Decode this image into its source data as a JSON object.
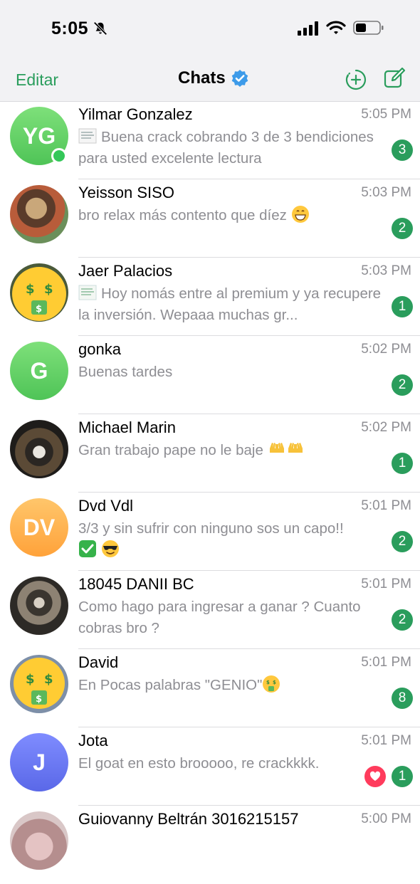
{
  "status": {
    "time": "5:05",
    "icons": [
      "bell-slash-icon",
      "signal-icon",
      "wifi-icon",
      "battery-icon"
    ]
  },
  "nav": {
    "edit": "Editar",
    "title": "Chats",
    "icons": [
      "verified-icon",
      "new-story-icon",
      "compose-icon"
    ]
  },
  "colors": {
    "accent": "#2a9d5c",
    "muted": "#8e8e93",
    "online": "#34c759",
    "heart": "#ff3b5c"
  },
  "chats": [
    {
      "name": "Yilmar Gonzalez",
      "time": "5:05 PM",
      "initials": "YG",
      "preview": "Buena crack cobrando 3 de 3 bendiciones para usted excelente lectura",
      "unread": "3",
      "online": true,
      "has_doc_icon": true
    },
    {
      "name": "Yeisson SISO",
      "time": "5:03 PM",
      "preview": "bro relax más contento que díez",
      "preview_emoji": "grinning-face",
      "unread": "2"
    },
    {
      "name": "Jaer Palacios",
      "time": "5:03 PM",
      "preview": "Hoy nomás entre al premium y ya recupere la inversión. Wepaaa muchas gr...",
      "unread": "1",
      "has_doc_icon": true,
      "avatar_emoji": "money-mouth-face"
    },
    {
      "name": "gonka",
      "time": "5:02 PM",
      "initials": "G",
      "preview": "Buenas tardes",
      "unread": "2"
    },
    {
      "name": "Michael Marin",
      "time": "5:02 PM",
      "preview": "Gran trabajo pape no le baje",
      "preview_emoji": "raising-hands x2",
      "unread": "1"
    },
    {
      "name": "Dvd Vdl",
      "time": "5:01 PM",
      "initials": "DV",
      "preview": "3/3 y sin sufrir con ninguno sos un capo!!",
      "preview_emoji": "check-mark + sunglasses-face",
      "unread": "2"
    },
    {
      "name": "18045 DANII BC",
      "time": "5:01 PM",
      "preview": "Como hago para ingresar a ganar ? Cuanto cobras bro ?",
      "unread": "2"
    },
    {
      "name": "David",
      "time": "5:01 PM",
      "preview": "En Pocas palabras \"GENIO\"",
      "preview_emoji": "money-mouth-face",
      "unread": "8",
      "avatar_emoji": "money-mouth-face"
    },
    {
      "name": "Jota",
      "time": "5:01 PM",
      "initials": "J",
      "preview": "El goat en esto brooooo, re crackkkk.",
      "unread": "1",
      "reaction": "heart-icon"
    },
    {
      "name": "Guiovanny Beltrán 3016215157",
      "time": "5:00 PM"
    }
  ]
}
